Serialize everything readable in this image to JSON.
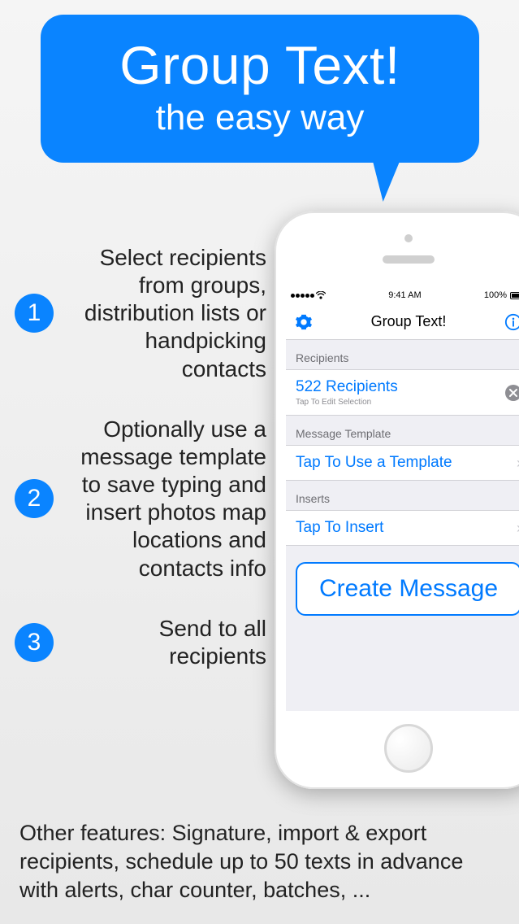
{
  "bubble": {
    "title": "Group Text!",
    "subtitle": "the easy way"
  },
  "steps": [
    {
      "num": "1",
      "text": "Select recipients from groups, distribution lists or handpicking contacts"
    },
    {
      "num": "2",
      "text": "Optionally use a message template to save typing and insert photos map locations and contacts info"
    },
    {
      "num": "3",
      "text": "Send to all recipients"
    }
  ],
  "footer": "Other features: Signature, import & export recipients, schedule up to 50 texts in advance with alerts, char counter, batches, ...",
  "statusbar": {
    "time": "9:41 AM",
    "battery": "100%"
  },
  "navbar": {
    "title": "Group Text!"
  },
  "sections": {
    "recipients": {
      "header": "Recipients",
      "title": "522 Recipients",
      "subtitle": "Tap To Edit Selection"
    },
    "template": {
      "header": "Message Template",
      "title": "Tap To Use a Template"
    },
    "inserts": {
      "header": "Inserts",
      "title": "Tap To Insert"
    }
  },
  "create_button": "Create Message"
}
